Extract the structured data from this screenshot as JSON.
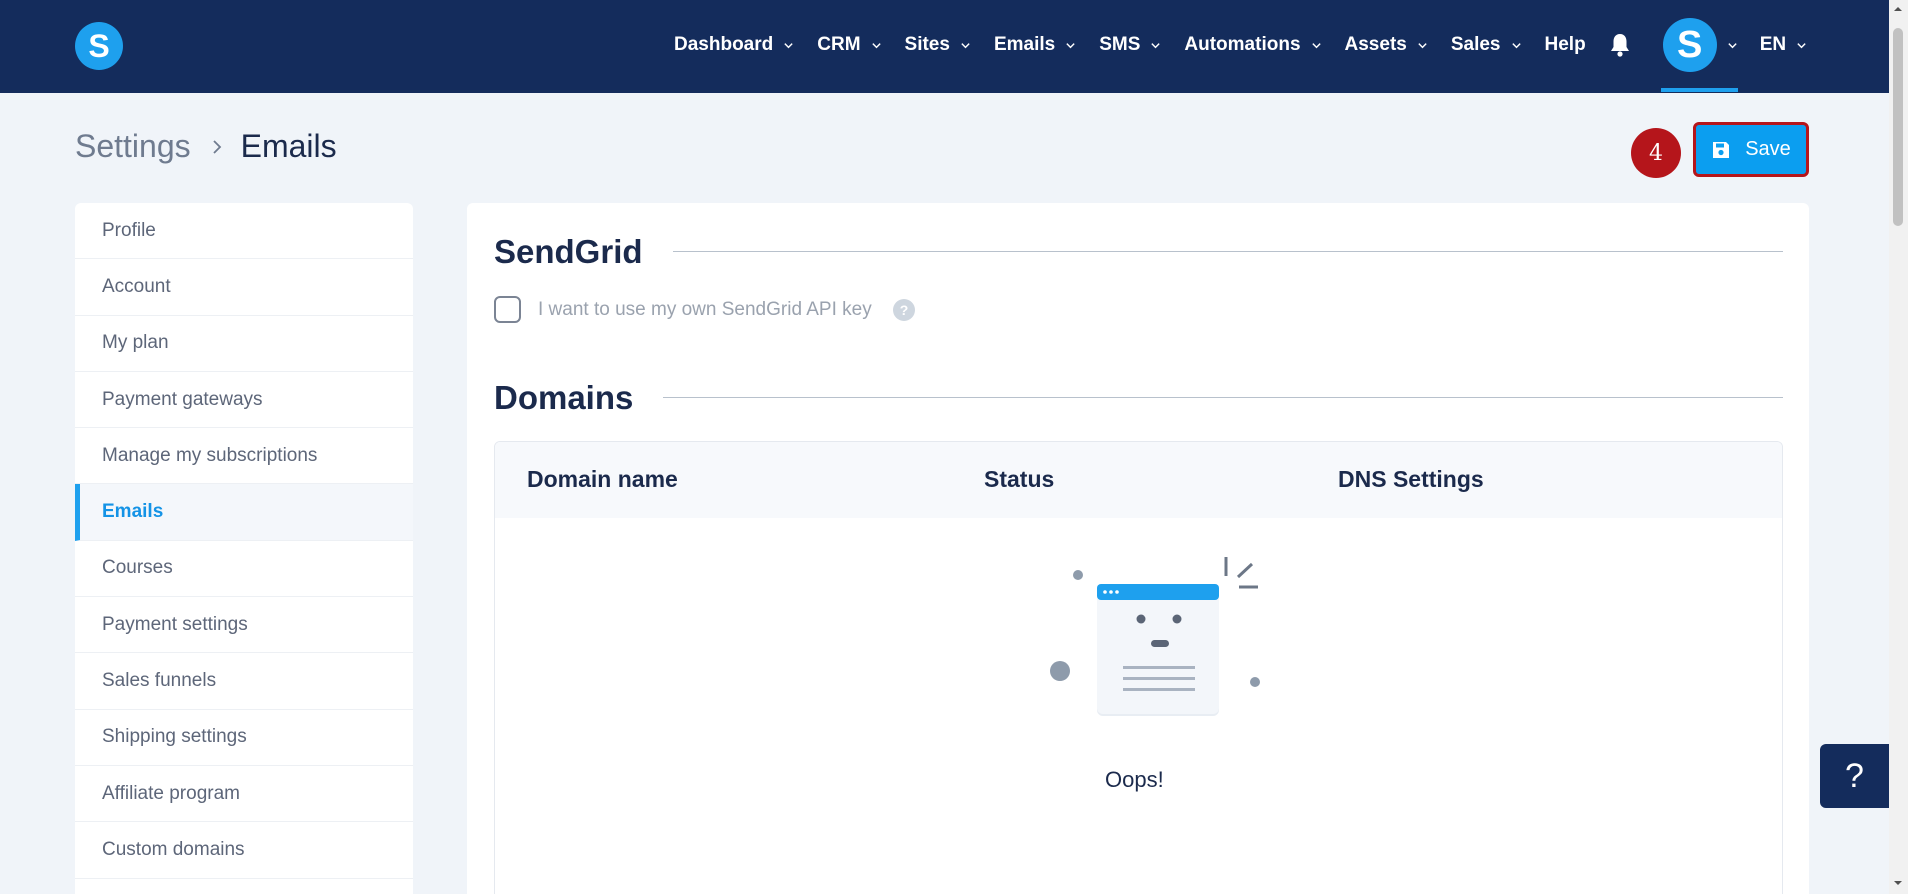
{
  "nav": {
    "logo_letter": "S",
    "items": [
      {
        "label": "Dashboard"
      },
      {
        "label": "CRM"
      },
      {
        "label": "Sites"
      },
      {
        "label": "Emails"
      },
      {
        "label": "SMS"
      },
      {
        "label": "Automations"
      },
      {
        "label": "Assets"
      },
      {
        "label": "Sales"
      }
    ],
    "help": "Help",
    "avatar_letter": "S",
    "language": "EN"
  },
  "breadcrumb": {
    "parent": "Settings",
    "current": "Emails"
  },
  "step_badge": "4",
  "save_label": "Save",
  "sidebar": {
    "items": [
      {
        "label": "Profile"
      },
      {
        "label": "Account"
      },
      {
        "label": "My plan"
      },
      {
        "label": "Payment gateways"
      },
      {
        "label": "Manage my subscriptions"
      },
      {
        "label": "Emails",
        "active": true
      },
      {
        "label": "Courses"
      },
      {
        "label": "Payment settings"
      },
      {
        "label": "Sales funnels"
      },
      {
        "label": "Shipping settings"
      },
      {
        "label": "Affiliate program"
      },
      {
        "label": "Custom domains"
      }
    ]
  },
  "sendgrid": {
    "title": "SendGrid",
    "checkbox_label": "I want to use my own SendGrid API key",
    "help_glyph": "?"
  },
  "domains": {
    "title": "Domains",
    "columns": [
      "Domain name",
      "Status",
      "DNS Settings"
    ],
    "empty_text": "Oops!"
  },
  "help_float": "?",
  "colors": {
    "navbar": "#142c5c",
    "accent": "#1ea0ee",
    "save_button": "#0b9ef0",
    "highlight_border": "#b5151b"
  }
}
